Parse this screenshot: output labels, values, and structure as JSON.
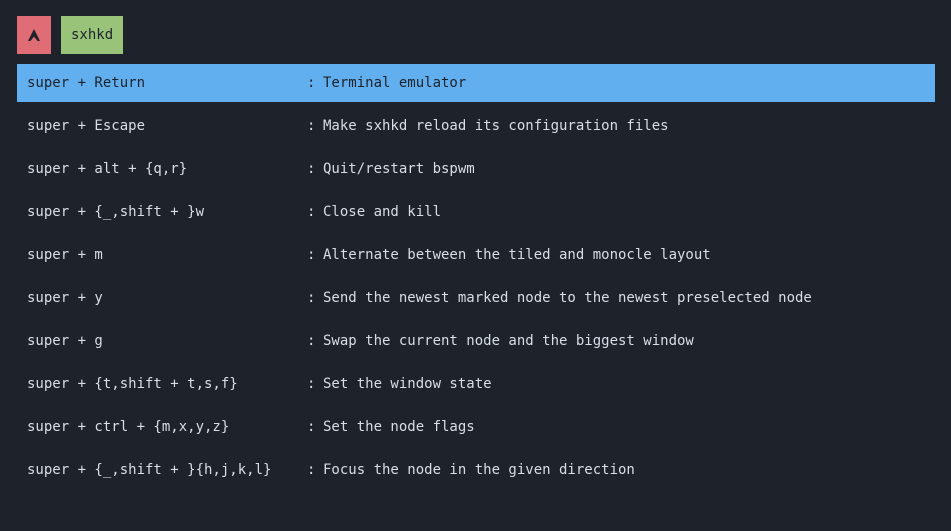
{
  "colors": {
    "background": "#1e222a",
    "text": "#d8dee9",
    "selected_bg": "#61afef",
    "selected_text": "#1e222a",
    "logo_bg": "#e06c75",
    "logo_fg": "#1e222a",
    "prompt_bg": "#98c379",
    "prompt_text": "#1e222a"
  },
  "header": {
    "logo_icon": "arch-linux-icon",
    "prompt": "sxhkd"
  },
  "entries": [
    {
      "key": "super + Return",
      "sep": ":",
      "desc": "Terminal emulator",
      "selected": true
    },
    {
      "key": "super + Escape",
      "sep": ":",
      "desc": "Make sxhkd reload its configuration files",
      "selected": false
    },
    {
      "key": "super + alt + {q,r}",
      "sep": ":",
      "desc": "Quit/restart bspwm",
      "selected": false
    },
    {
      "key": "super + {_,shift + }w",
      "sep": ":",
      "desc": "Close and kill",
      "selected": false
    },
    {
      "key": "super + m",
      "sep": ":",
      "desc": "Alternate between the tiled and monocle layout",
      "selected": false
    },
    {
      "key": "super + y",
      "sep": ":",
      "desc": "Send the newest marked node to the newest preselected node",
      "selected": false
    },
    {
      "key": "super + g",
      "sep": ":",
      "desc": "Swap the current node and the biggest window",
      "selected": false
    },
    {
      "key": "super + {t,shift + t,s,f}",
      "sep": ":",
      "desc": "Set the window state",
      "selected": false
    },
    {
      "key": "super + ctrl + {m,x,y,z}",
      "sep": ":",
      "desc": "Set the node flags",
      "selected": false
    },
    {
      "key": "super + {_,shift + }{h,j,k,l}",
      "sep": ":",
      "desc": "Focus the node in the given direction",
      "selected": false
    }
  ]
}
